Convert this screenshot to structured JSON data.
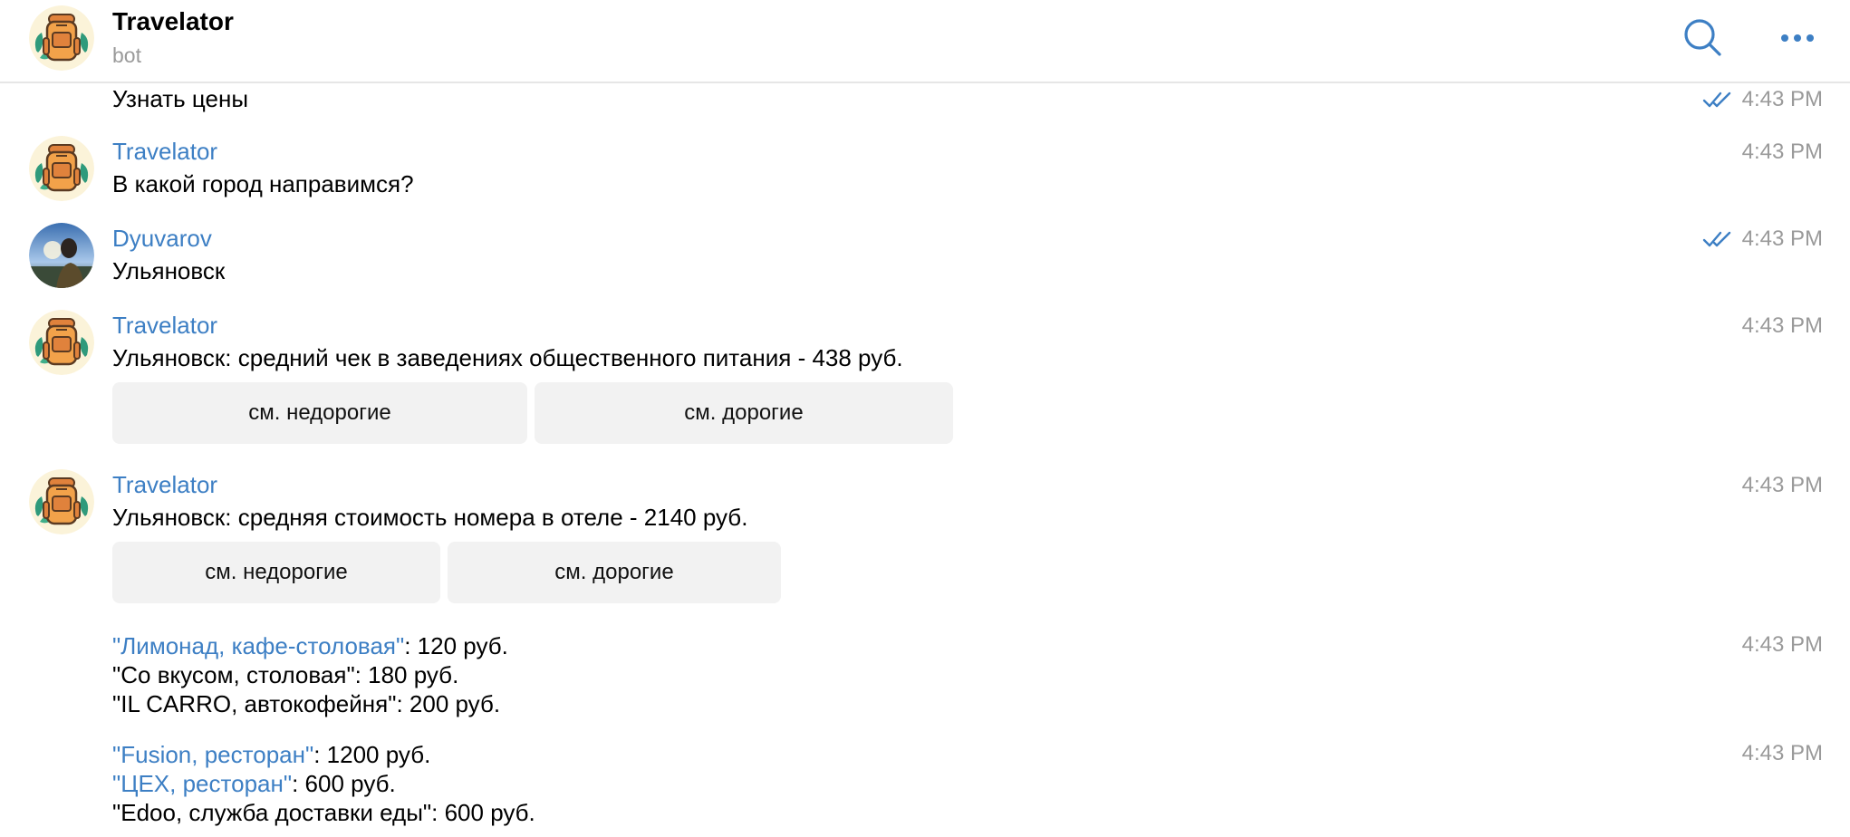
{
  "header": {
    "title": "Travelator",
    "subtitle": "bot",
    "search_icon": "search-icon",
    "more_icon": "more-dots-icon"
  },
  "messages": [
    {
      "text": "Узнать цены",
      "time": "4:43 PM",
      "read": true
    },
    {
      "sender": "Travelator",
      "text": "В какой город направимся?",
      "time": "4:43 PM"
    },
    {
      "sender": "Dyuvarov",
      "text": "Ульяновск",
      "time": "4:43 PM",
      "read": true
    },
    {
      "sender": "Travelator",
      "text": "Ульяновск: средний чек в заведениях общественного питания - 438 руб.",
      "time": "4:43 PM",
      "buttons": [
        "см. недорогие",
        "см. дорогие"
      ]
    },
    {
      "sender": "Travelator",
      "text": "Ульяновск: средняя стоимость номера в отеле - 2140 руб.",
      "time": "4:43 PM",
      "buttons": [
        "см. недорогие",
        "см. дорогие"
      ]
    },
    {
      "time": "4:43 PM",
      "lines": [
        {
          "link": "\"Лимонад, кафе-столовая\"",
          "rest": ": 120 руб."
        },
        {
          "link": "",
          "rest": "\"Со вкусом, столовая\": 180 руб."
        },
        {
          "link": "",
          "rest": "\"IL CARRO, автокофейня\": 200 руб."
        }
      ]
    },
    {
      "time": "4:43 PM",
      "lines": [
        {
          "link": "\"Fusion, ресторан\"",
          "rest": ": 1200 руб."
        },
        {
          "link": "\"ЦЕХ, ресторан\"",
          "rest": ": 600 руб."
        },
        {
          "link": "",
          "rest": "\"Edoo, служба доставки еды\": 600 руб."
        }
      ]
    }
  ]
}
